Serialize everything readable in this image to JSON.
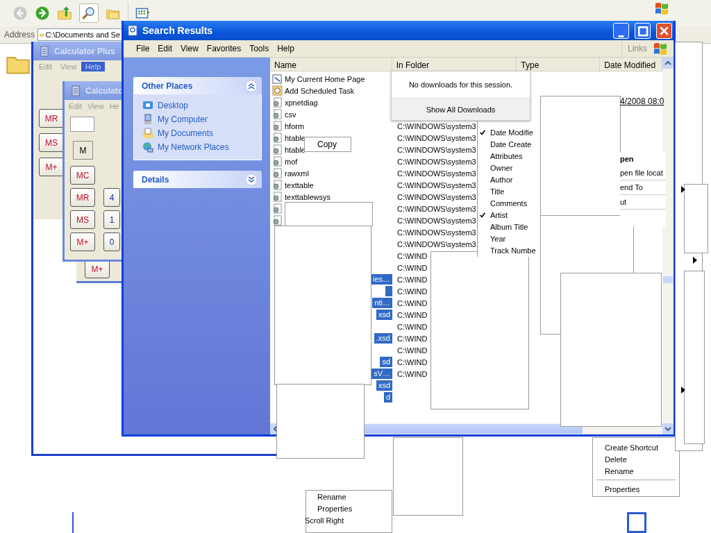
{
  "explorer": {
    "address_label": "Address",
    "address": "C:\\Documents and Se"
  },
  "calculator_plus": {
    "title": "Calculator Plus",
    "menu": [
      {
        "label": "Edit",
        "selected": false
      },
      {
        "label": "View",
        "selected": false
      },
      {
        "label": "Help",
        "selected": true
      }
    ],
    "buttons": [
      "MR",
      "MS",
      "M+"
    ]
  },
  "calculator": {
    "title": "Calculato",
    "menu": [
      "Edit",
      "View",
      "He"
    ],
    "memory": "M",
    "memory_buttons": [
      "MC",
      "MR",
      "MS",
      "M+"
    ],
    "digits": [
      "4",
      "1",
      "0"
    ]
  },
  "calculator_behind": {
    "button": "M+"
  },
  "search_window": {
    "title": "Search Results",
    "menu": [
      "File",
      "Edit",
      "View",
      "Favorites",
      "Tools",
      "Help"
    ],
    "links": "Links",
    "panels": [
      {
        "title": "Other Places",
        "expanded": true,
        "items": [
          {
            "label": "Desktop",
            "kind": "desktop"
          },
          {
            "label": "My Computer",
            "kind": "computer"
          },
          {
            "label": "My Documents",
            "kind": "documents"
          },
          {
            "label": "My Network Places",
            "kind": "network"
          }
        ]
      },
      {
        "title": "Details",
        "expanded": false
      }
    ],
    "columns": [
      "Name",
      "In Folder",
      "Type",
      "Date Modified"
    ],
    "rows": [
      {
        "name": "My Current Home Page",
        "kind": "page",
        "selected": false
      },
      {
        "name": "Add Scheduled Task",
        "kind": "task",
        "selected": false
      },
      {
        "name": "xpnetdiag",
        "kind": "script",
        "selected": false
      },
      {
        "name": "csv",
        "kind": "script",
        "selected": false
      },
      {
        "name": "hform",
        "kind": "script",
        "folder": "C:\\WINDOWS\\system3",
        "selected": false
      },
      {
        "name": "htable",
        "kind": "script",
        "folder": "C:\\WINDOWS\\system3",
        "selected": false
      },
      {
        "name": "htable",
        "kind": "script",
        "folder": "C:\\WINDOWS\\system3",
        "selected": false
      },
      {
        "name": "mof",
        "kind": "script",
        "folder": "C:\\WINDOWS\\system3",
        "selected": false
      },
      {
        "name": "rawxml",
        "kind": "script",
        "folder": "C:\\WINDOWS\\system3",
        "selected": false
      },
      {
        "name": "texttable",
        "kind": "script",
        "folder": "C:\\WINDOWS\\system3",
        "selected": false
      },
      {
        "name": "texttablewsys",
        "kind": "script",
        "folder": "C:\\WINDOWS\\system3",
        "selected": false
      },
      {
        "kind": "script",
        "folder": "C:\\WINDOWS\\system3",
        "selected": false
      },
      {
        "kind": "script",
        "folder": "C:\\WINDOWS\\system3",
        "selected": false
      },
      {
        "folder": "C:\\WINDOWS\\system3",
        "selected": false
      },
      {
        "folder": "C:\\WINDOWS\\system3",
        "selected": false
      },
      {
        "folder": "C:\\WIND",
        "selected": false
      },
      {
        "folder": "C:\\WIND",
        "selected": false
      },
      {
        "name": "ies…",
        "folder": "C:\\WIND",
        "selected": true
      },
      {
        "folder": "C:\\WIND",
        "selected": true
      },
      {
        "name": "nti…",
        "folder": "C:\\WIND",
        "selected": true
      },
      {
        "name": "xsd",
        "folder": "C:\\WIND",
        "selected": true
      },
      {
        "folder": "C:\\WIND",
        "selected": false
      },
      {
        "name": ".xsd",
        "folder": "C:\\WIND",
        "selected": true
      },
      {
        "folder": "C:\\WIND",
        "selected": false
      },
      {
        "name": "sd",
        "folder": "C:\\WIND",
        "selected": true
      },
      {
        "name": "sV…",
        "folder": "C:\\WIND",
        "selected": true
      },
      {
        "name": "xsd",
        "selected": true
      },
      {
        "name": "d",
        "selected": true
      }
    ],
    "date_fragment": "4/2008 08:0"
  },
  "downloads_popup": {
    "message": "No downloads for this session.",
    "button": "Show All Downloads"
  },
  "copy_menu": {
    "label": "Copy"
  },
  "column_menu": [
    {
      "label": "Date Modifie",
      "checked": true
    },
    {
      "label": "Date Create",
      "checked": false
    },
    {
      "label": "Attributes",
      "checked": false
    },
    {
      "label": "Owner",
      "checked": false
    },
    {
      "label": "Author",
      "checked": false
    },
    {
      "label": "Title",
      "checked": false
    },
    {
      "label": "Comments",
      "checked": false
    },
    {
      "label": "Artist",
      "checked": true
    },
    {
      "label": "Album Title",
      "checked": false
    },
    {
      "label": "Year",
      "checked": false
    },
    {
      "label": "Track Numbe",
      "checked": false
    }
  ],
  "file_menu_fragment": [
    {
      "label": "pen",
      "kind": "default"
    },
    {
      "label": "pen file locat",
      "kind": "item"
    },
    {
      "label": "end To",
      "kind": "submenu"
    },
    {
      "label": "ut",
      "kind": "item"
    }
  ],
  "context_menu": [
    {
      "label": "Create Shortcut",
      "kind": "item"
    },
    {
      "label": "Delete",
      "kind": "item"
    },
    {
      "label": "Rename",
      "kind": "item"
    },
    {
      "kind": "separator"
    },
    {
      "label": "Properties",
      "kind": "item"
    }
  ],
  "ghost_menu": [
    "Rename",
    "Properties",
    "Scroll Right"
  ]
}
